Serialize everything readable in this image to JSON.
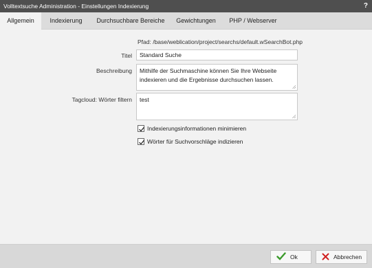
{
  "window": {
    "title": "Volltextsuche Administration - Einstellungen Indexierung",
    "help_label": "?"
  },
  "tabs": [
    {
      "label": "Allgemein",
      "active": true
    },
    {
      "label": "Indexierung",
      "active": false
    },
    {
      "label": "Durchsuchbare Bereiche",
      "active": false
    },
    {
      "label": "Gewichtungen",
      "active": false
    },
    {
      "label": "PHP / Webserver",
      "active": false
    }
  ],
  "form": {
    "path_text": "Pfad: /base/weblication/project/searchs/default.wSearchBot.php",
    "title_label": "Titel",
    "title_value": "Standard Suche",
    "description_label": "Beschreibung",
    "description_value": "Mithilfe der Suchmaschine können Sie Ihre Webseite indexieren und die Ergebnisse durchsuchen lassen.",
    "tagcloud_label": "Tagcloud: Wörter filtern",
    "tagcloud_value": "test",
    "minimize_label": "Indexierungsinformationen minimieren",
    "minimize_checked": true,
    "suggest_label": "Wörter für Suchvorschläge indizieren",
    "suggest_checked": true
  },
  "footer": {
    "ok_label": "Ok",
    "cancel_label": "Abbrechen"
  },
  "colors": {
    "titlebar": "#4f4f4f",
    "tabbar": "#dcdcdc",
    "ok_icon": "#3a9a2a",
    "cancel_icon": "#d02020"
  },
  "icons": {
    "ok": "checkmark-icon",
    "cancel": "x-icon",
    "checkbox": "checkmark-icon"
  }
}
